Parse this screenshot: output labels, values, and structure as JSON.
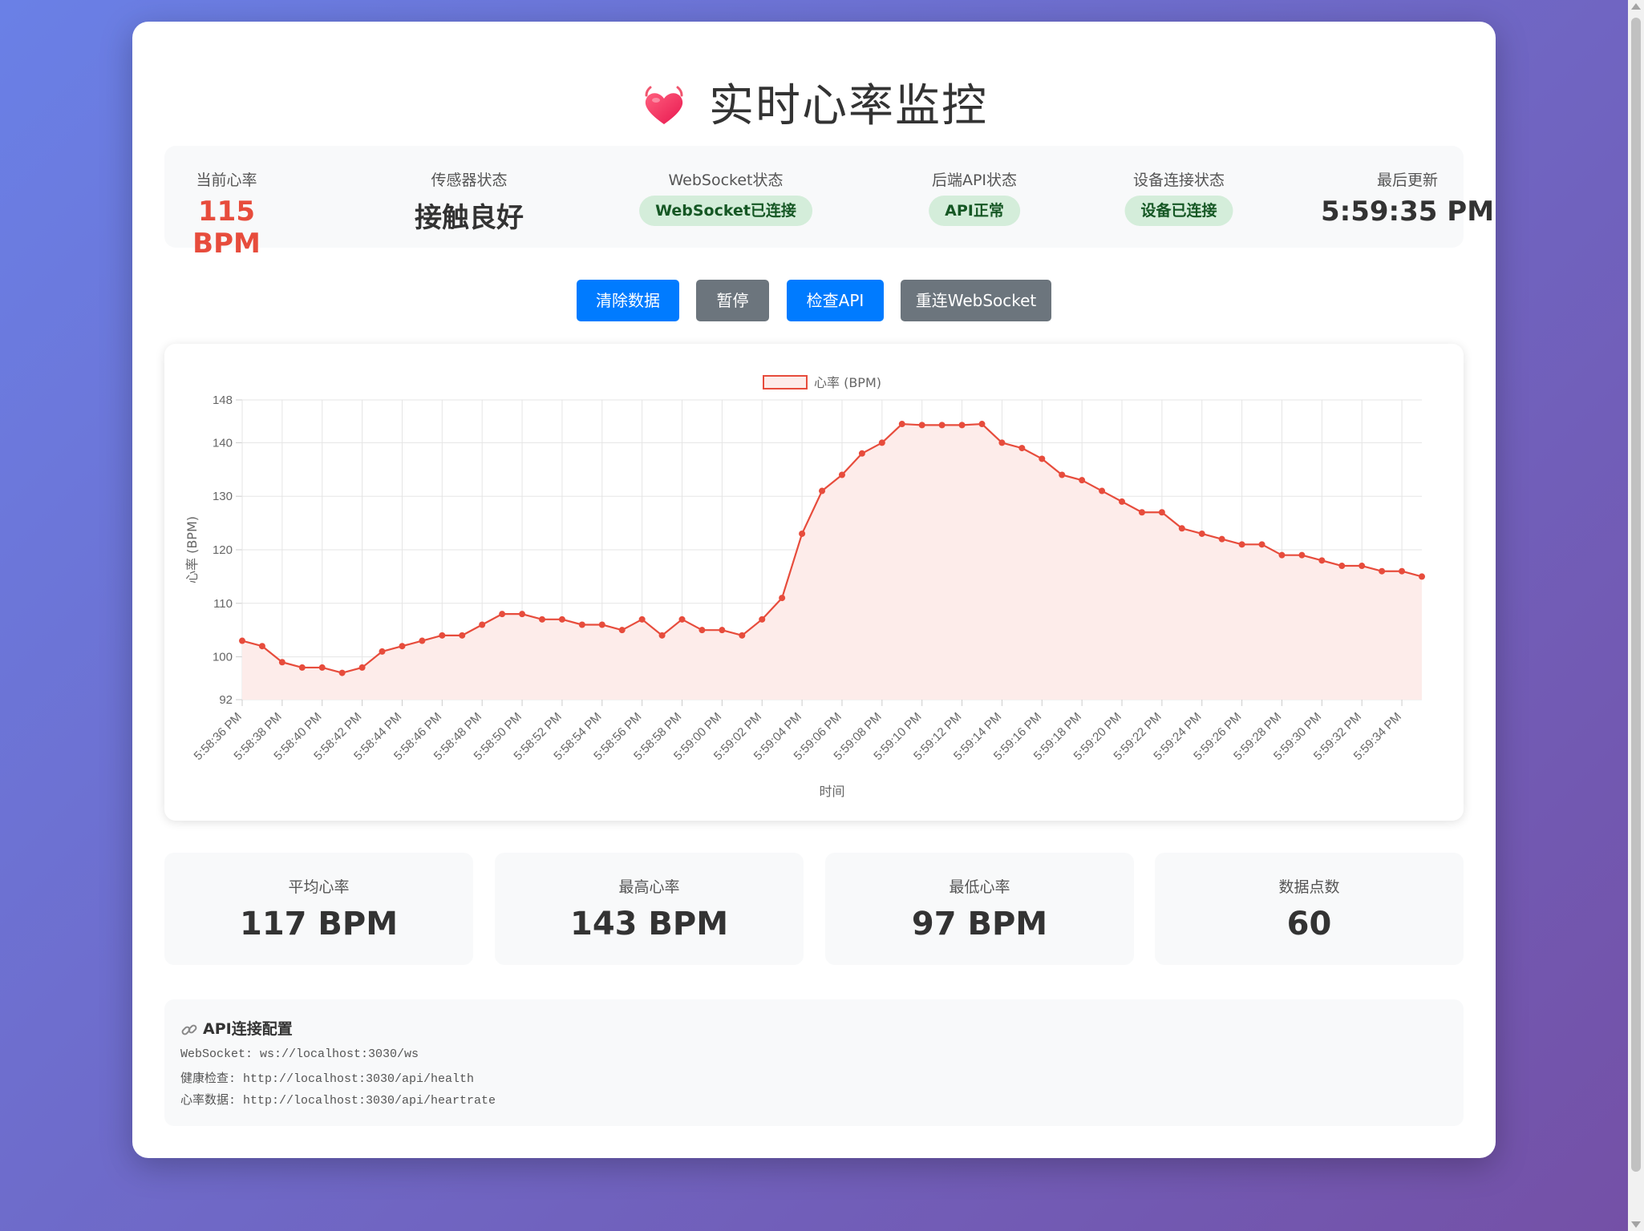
{
  "title": "实时心率监控",
  "status": {
    "current_hr_label": "当前心率",
    "current_hr_value": "115 BPM",
    "sensor_label": "传感器状态",
    "sensor_value": "接触良好",
    "ws_label": "WebSocket状态",
    "ws_badge": "WebSocket已连接",
    "api_label": "后端API状态",
    "api_badge": "API正常",
    "device_label": "设备连接状态",
    "device_badge": "设备已连接",
    "last_update_label": "最后更新",
    "last_update_value": "5:59:35 PM"
  },
  "buttons": {
    "clear": "清除数据",
    "pause": "暂停",
    "check_api": "检查API",
    "reconnect_ws": "重连WebSocket"
  },
  "chart_data": {
    "type": "area",
    "legend": "心率 (BPM)",
    "legend_position": "top",
    "xlabel": "时间",
    "ylabel": "心率 (BPM)",
    "ylim": [
      92,
      148
    ],
    "yticks": [
      92,
      100,
      110,
      120,
      130,
      140,
      148
    ],
    "grid": true,
    "line_color": "#e74c3c",
    "fill_color": "#fdecea",
    "x": [
      "5:58:36 PM",
      "5:58:37 PM",
      "5:58:38 PM",
      "5:58:39 PM",
      "5:58:40 PM",
      "5:58:41 PM",
      "5:58:42 PM",
      "5:58:43 PM",
      "5:58:44 PM",
      "5:58:45 PM",
      "5:58:46 PM",
      "5:58:47 PM",
      "5:58:48 PM",
      "5:58:49 PM",
      "5:58:50 PM",
      "5:58:51 PM",
      "5:58:52 PM",
      "5:58:53 PM",
      "5:58:54 PM",
      "5:58:55 PM",
      "5:58:56 PM",
      "5:58:57 PM",
      "5:58:58 PM",
      "5:58:59 PM",
      "5:59:00 PM",
      "5:59:01 PM",
      "5:59:02 PM",
      "5:59:03 PM",
      "5:59:04 PM",
      "5:59:05 PM",
      "5:59:06 PM",
      "5:59:07 PM",
      "5:59:08 PM",
      "5:59:09 PM",
      "5:59:10 PM",
      "5:59:11 PM",
      "5:59:12 PM",
      "5:59:13 PM",
      "5:59:14 PM",
      "5:59:15 PM",
      "5:59:16 PM",
      "5:59:17 PM",
      "5:59:18 PM",
      "5:59:19 PM",
      "5:59:20 PM",
      "5:59:21 PM",
      "5:59:22 PM",
      "5:59:23 PM",
      "5:59:24 PM",
      "5:59:25 PM",
      "5:59:26 PM",
      "5:59:27 PM",
      "5:59:28 PM",
      "5:59:29 PM",
      "5:59:30 PM",
      "5:59:31 PM",
      "5:59:32 PM",
      "5:59:33 PM",
      "5:59:34 PM",
      "5:59:35 PM"
    ],
    "x_tick_labels": [
      "5:58:36 PM",
      "5:58:38 PM",
      "5:58:40 PM",
      "5:58:42 PM",
      "5:58:44 PM",
      "5:58:46 PM",
      "5:58:48 PM",
      "5:58:50 PM",
      "5:58:52 PM",
      "5:58:54 PM",
      "5:58:56 PM",
      "5:58:58 PM",
      "5:59:00 PM",
      "5:59:02 PM",
      "5:59:04 PM",
      "5:59:06 PM",
      "5:59:08 PM",
      "5:59:10 PM",
      "5:59:12 PM",
      "5:59:14 PM",
      "5:59:16 PM",
      "5:59:18 PM",
      "5:59:20 PM",
      "5:59:22 PM",
      "5:59:24 PM",
      "5:59:26 PM",
      "5:59:28 PM",
      "5:59:30 PM",
      "5:59:32 PM",
      "5:59:34 PM"
    ],
    "values": [
      103,
      102,
      99,
      98,
      98,
      97,
      98,
      101,
      102,
      103,
      104,
      104,
      106,
      108,
      108,
      107,
      107,
      106,
      106,
      105,
      107,
      104,
      107,
      105,
      105,
      104,
      107,
      111,
      123,
      131,
      134,
      138,
      140,
      143.5,
      143.3,
      143.3,
      143.3,
      143.5,
      140,
      139,
      137,
      134,
      133,
      131,
      129,
      127,
      127,
      124,
      123,
      122,
      121,
      121,
      119,
      119,
      118,
      117,
      117,
      116,
      116,
      115
    ]
  },
  "summary": [
    {
      "label": "平均心率",
      "value": "117 BPM"
    },
    {
      "label": "最高心率",
      "value": "143 BPM"
    },
    {
      "label": "最低心率",
      "value": "97 BPM"
    },
    {
      "label": "数据点数",
      "value": "60"
    }
  ],
  "api_config": {
    "title": "API连接配置",
    "lines": [
      "WebSocket: ws://localhost:3030/ws",
      "健康检查: http://localhost:3030/api/health",
      "心率数据: http://localhost:3030/api/heartrate"
    ]
  }
}
